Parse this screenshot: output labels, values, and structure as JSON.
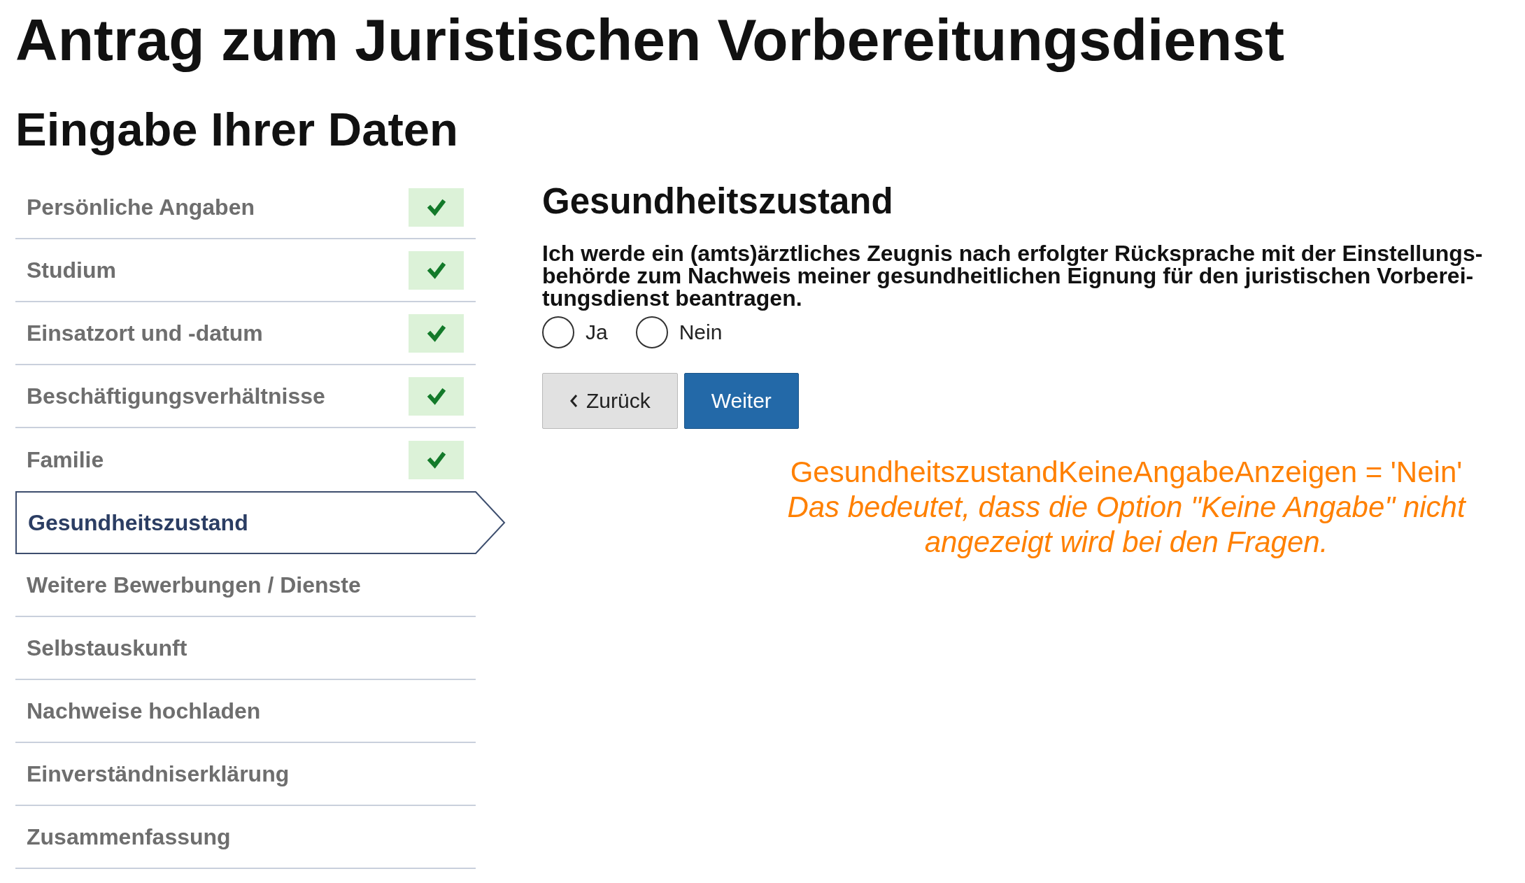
{
  "page": {
    "title": "Antrag zum Juristischen Vorbereitungsdienst",
    "subtitle": "Eingabe Ihrer Daten"
  },
  "steps": [
    {
      "label": "Persönliche Angaben",
      "completed": true,
      "selected": false
    },
    {
      "label": "Studium",
      "completed": true,
      "selected": false
    },
    {
      "label": "Einsatzort und -datum",
      "completed": true,
      "selected": false
    },
    {
      "label": "Beschäftigungsverhältnisse",
      "completed": true,
      "selected": false
    },
    {
      "label": "Familie",
      "completed": true,
      "selected": false
    },
    {
      "label": "Gesundheitszustand",
      "completed": false,
      "selected": true
    },
    {
      "label": "Weitere Bewerbungen / Dienste",
      "completed": false,
      "selected": false
    },
    {
      "label": "Selbstauskunft",
      "completed": false,
      "selected": false
    },
    {
      "label": "Nachweise hochladen",
      "completed": false,
      "selected": false
    },
    {
      "label": "Einverständniserklärung",
      "completed": false,
      "selected": false
    },
    {
      "label": "Zusammenfassung",
      "completed": false,
      "selected": false
    }
  ],
  "section": {
    "title": "Gesundheitszustand",
    "question": "Ich werde ein (amts)ärztliches Zeugnis nach erfolgter Rücksprache mit der Einstellungs-\nbehörde zum Nachweis meiner gesundheitlichen Eignung für den juristischen Vorberei-\ntungsdienst beantragen.",
    "options": [
      {
        "label": "Ja",
        "selected": false
      },
      {
        "label": "Nein",
        "selected": false
      }
    ]
  },
  "buttons": [
    {
      "label": "Zurück",
      "kind": "back"
    },
    {
      "label": "Weiter",
      "kind": "primary"
    }
  ],
  "annotation": {
    "code": "GesundheitszustandKeineAngabeAnzeigen = 'Nein'",
    "note": "Das bedeutet, dass die Option \"Keine Angabe\" nicht angezeigt wird bei den Fragen."
  }
}
